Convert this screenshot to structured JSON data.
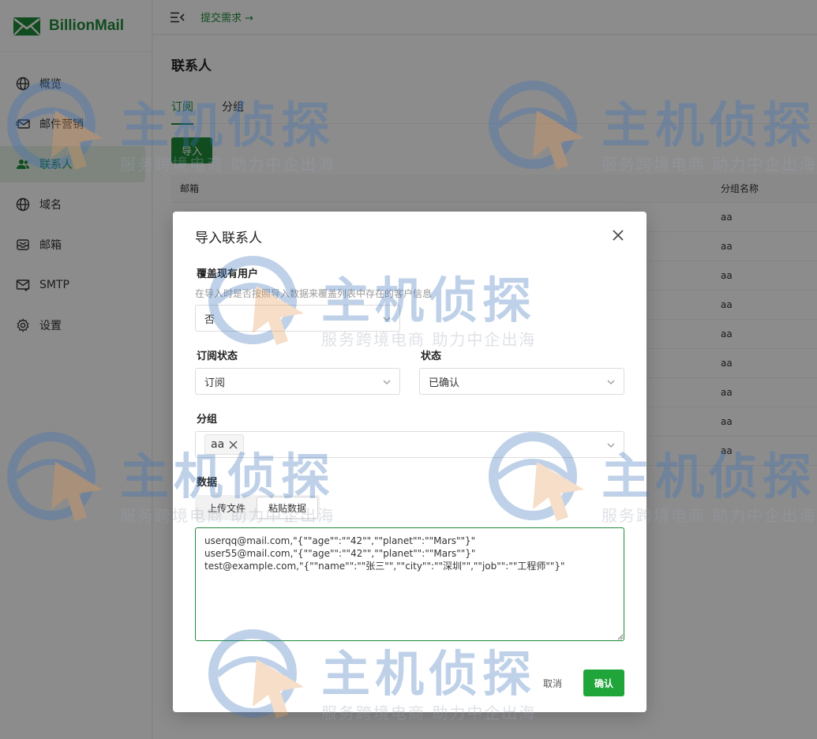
{
  "app": {
    "name": "BillionMail"
  },
  "sidebar": {
    "items": [
      {
        "label": "概览",
        "icon": "globe-icon"
      },
      {
        "label": "邮件营销",
        "icon": "mail-send-icon"
      },
      {
        "label": "联系人",
        "icon": "users-icon",
        "active": true
      },
      {
        "label": "域名",
        "icon": "globe-icon"
      },
      {
        "label": "邮箱",
        "icon": "inbox-icon"
      },
      {
        "label": "SMTP",
        "icon": "mail-check-icon"
      },
      {
        "label": "设置",
        "icon": "gear-icon"
      }
    ]
  },
  "topbar": {
    "submit_link": "提交需求 →"
  },
  "page": {
    "title": "联系人",
    "tabs": [
      "订阅",
      "分组"
    ],
    "import_button": "导入",
    "table": {
      "columns": [
        "邮箱",
        "分组名称"
      ],
      "rows": [
        "aa",
        "aa",
        "aa",
        "aa",
        "aa",
        "aa",
        "aa",
        "aa",
        "aa"
      ]
    }
  },
  "watermark": {
    "title": "主机侦探",
    "subtitle": "服务跨境电商 助力中企出海"
  },
  "modal": {
    "title": "导入联系人",
    "overwrite": {
      "label": "覆盖现有用户",
      "hint": "在导入时是否按照导入数据来覆盖列表中存在的客户信息",
      "value": "否"
    },
    "subscription": {
      "label": "订阅状态",
      "value": "订阅"
    },
    "status": {
      "label": "状态",
      "value": "已确认"
    },
    "group": {
      "label": "分组",
      "tag": "aa"
    },
    "data": {
      "label": "数据",
      "modes": [
        "上传文件",
        "粘贴数据"
      ],
      "content": "userqq@mail.com,\"{\"\"age\"\":\"\"42\"\",\"\"planet\"\":\"\"Mars\"\"}\"\nuser55@mail.com,\"{\"\"age\"\":\"\"42\"\",\"\"planet\"\":\"\"Mars\"\"}\"\ntest@example.com,\"{\"\"name\"\":\"\"张三\"\",\"\"city\"\":\"\"深圳\"\",\"\"job\"\":\"\"工程师\"\"}\""
    },
    "cancel": "取消",
    "confirm": "确认"
  },
  "colors": {
    "brand": "#1f8a3a",
    "primary_button": "#20a53a"
  }
}
